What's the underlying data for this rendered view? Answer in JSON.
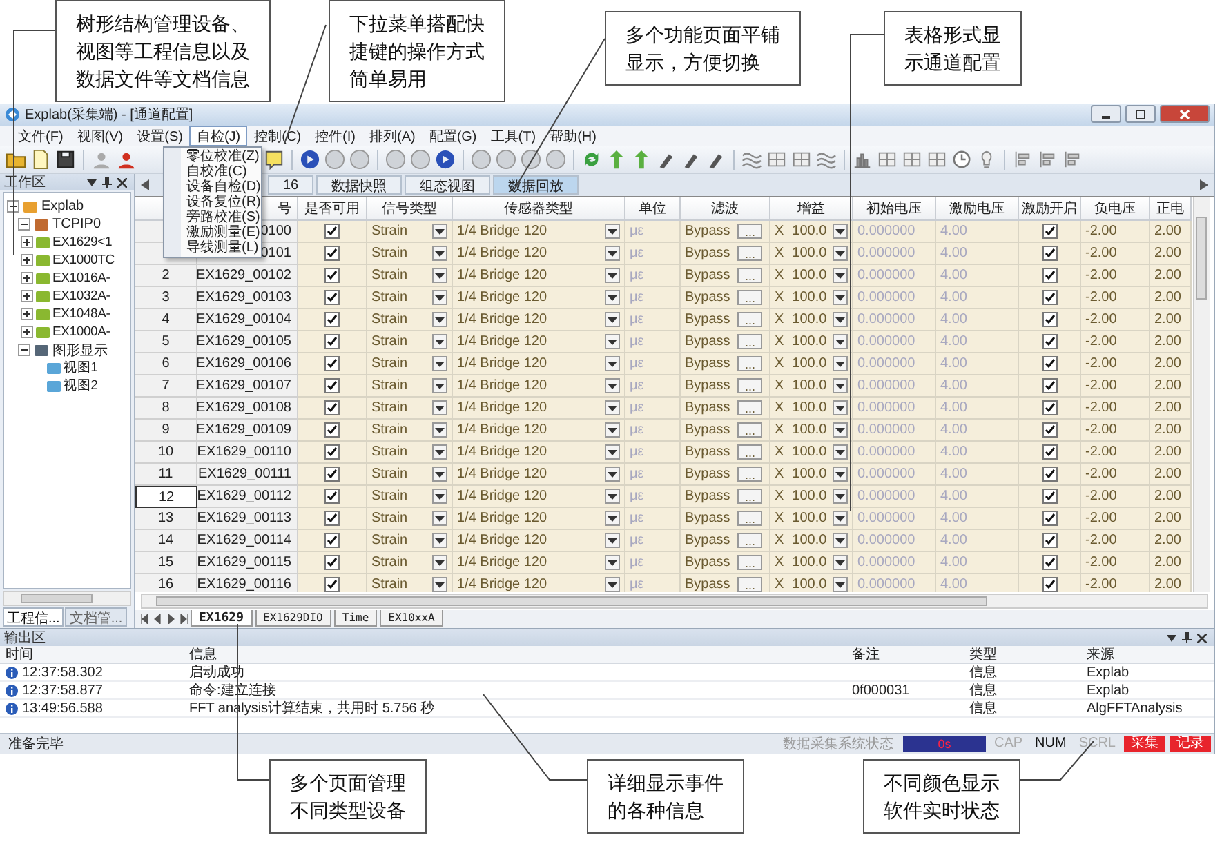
{
  "callouts_top": [
    {
      "text": "树形结构管理设备、视图等工程信息以及数据文件等文档信息"
    },
    {
      "text": "下拉菜单搭配快捷键的操作方式简单易用"
    },
    {
      "text": "多个功能页面平铺显示，方便切换"
    },
    {
      "text": "表格形式显示通道配置"
    }
  ],
  "window": {
    "title": "Explab(采集端) - [通道配置]"
  },
  "menu": [
    {
      "label": "文件(F)",
      "selected": false
    },
    {
      "label": "视图(V)",
      "selected": false
    },
    {
      "label": "设置(S)",
      "selected": false
    },
    {
      "label": "自检(J)",
      "selected": true
    },
    {
      "label": "控制(C)",
      "selected": false
    },
    {
      "label": "控件(I)",
      "selected": false
    },
    {
      "label": "排列(A)",
      "selected": false
    },
    {
      "label": "配置(G)",
      "selected": false
    },
    {
      "label": "工具(T)",
      "selected": false
    },
    {
      "label": "帮助(H)",
      "selected": false
    }
  ],
  "dropdown": [
    {
      "label": "零位校准(Z)"
    },
    {
      "label": "自校准(C)"
    },
    {
      "label": "设备自检(D)"
    },
    {
      "label": "设备复位(R)"
    },
    {
      "label": "旁路校准(S)"
    },
    {
      "label": "激励测量(E)"
    },
    {
      "label": "导线测量(L)"
    }
  ],
  "workspace": {
    "title": "工作区",
    "tree": [
      {
        "label": "Explab",
        "kind": "app",
        "expanded": true,
        "children": [
          {
            "label": "TCPIP0",
            "kind": "network",
            "expanded": true,
            "children": [
              {
                "label": "EX1629<1",
                "kind": "device",
                "expanded": false
              },
              {
                "label": "EX1000TC",
                "kind": "device",
                "expanded": false
              },
              {
                "label": "EX1016A-",
                "kind": "device",
                "expanded": false
              },
              {
                "label": "EX1032A-",
                "kind": "device",
                "expanded": false
              },
              {
                "label": "EX1048A-",
                "kind": "device",
                "expanded": false
              },
              {
                "label": "EX1000A-",
                "kind": "device",
                "expanded": false
              }
            ]
          },
          {
            "label": "图形显示",
            "kind": "monitor",
            "expanded": true,
            "children": [
              {
                "label": "视图1",
                "kind": "view"
              },
              {
                "label": "视图2",
                "kind": "view"
              }
            ]
          }
        ]
      }
    ],
    "tabs": [
      {
        "label": "工程信...",
        "selected": true
      },
      {
        "label": "文档管...",
        "selected": false
      }
    ]
  },
  "page_tabs": [
    {
      "label": "16",
      "selected": false
    },
    {
      "label": "数据快照",
      "selected": false
    },
    {
      "label": "组态视图",
      "selected": false
    },
    {
      "label": "数据回放",
      "selected": true
    }
  ],
  "table": {
    "columns": [
      "号",
      "是否可用",
      "信号类型",
      "传感器类型",
      "单位",
      "滤波",
      "增益",
      "初始电压",
      "激励电压",
      "激励开启",
      "负电压",
      "正电"
    ],
    "rows": [
      {
        "name": "0100",
        "selected": false,
        "enabled": true,
        "signal": "Strain",
        "sensor": "1/4 Bridge 120",
        "unit": "με",
        "filter": "Bypass",
        "filter_button": "...",
        "gain_prefix": "X",
        "gain": "100.0",
        "initial_voltage": "0.000000",
        "excitation_voltage": "4.00",
        "excitation_on": true,
        "negative_voltage": "-2.00",
        "positive_voltage": "2.00"
      },
      {
        "name": "0101",
        "selected": false,
        "enabled": true,
        "signal": "Strain",
        "sensor": "1/4 Bridge 120",
        "unit": "με",
        "filter": "Bypass",
        "filter_button": "...",
        "gain_prefix": "X",
        "gain": "100.0",
        "initial_voltage": "0.000000",
        "excitation_voltage": "4.00",
        "excitation_on": true,
        "negative_voltage": "-2.00",
        "positive_voltage": "2.00"
      },
      {
        "index": "2",
        "name": "EX1629_00102",
        "selected": false,
        "enabled": true,
        "signal": "Strain",
        "sensor": "1/4 Bridge 120",
        "unit": "με",
        "filter": "Bypass",
        "filter_button": "...",
        "gain_prefix": "X",
        "gain": "100.0",
        "initial_voltage": "0.000000",
        "excitation_voltage": "4.00",
        "excitation_on": true,
        "negative_voltage": "-2.00",
        "positive_voltage": "2.00"
      },
      {
        "index": "3",
        "name": "EX1629_00103",
        "selected": false,
        "enabled": true,
        "signal": "Strain",
        "sensor": "1/4 Bridge 120",
        "unit": "με",
        "filter": "Bypass",
        "filter_button": "...",
        "gain_prefix": "X",
        "gain": "100.0",
        "initial_voltage": "0.000000",
        "excitation_voltage": "4.00",
        "excitation_on": true,
        "negative_voltage": "-2.00",
        "positive_voltage": "2.00"
      },
      {
        "index": "4",
        "name": "EX1629_00104",
        "selected": false,
        "enabled": true,
        "signal": "Strain",
        "sensor": "1/4 Bridge 120",
        "unit": "με",
        "filter": "Bypass",
        "filter_button": "...",
        "gain_prefix": "X",
        "gain": "100.0",
        "initial_voltage": "0.000000",
        "excitation_voltage": "4.00",
        "excitation_on": true,
        "negative_voltage": "-2.00",
        "positive_voltage": "2.00"
      },
      {
        "index": "5",
        "name": "EX1629_00105",
        "selected": false,
        "enabled": true,
        "signal": "Strain",
        "sensor": "1/4 Bridge 120",
        "unit": "με",
        "filter": "Bypass",
        "filter_button": "...",
        "gain_prefix": "X",
        "gain": "100.0",
        "initial_voltage": "0.000000",
        "excitation_voltage": "4.00",
        "excitation_on": true,
        "negative_voltage": "-2.00",
        "positive_voltage": "2.00"
      },
      {
        "index": "6",
        "name": "EX1629_00106",
        "selected": false,
        "enabled": true,
        "signal": "Strain",
        "sensor": "1/4 Bridge 120",
        "unit": "με",
        "filter": "Bypass",
        "filter_button": "...",
        "gain_prefix": "X",
        "gain": "100.0",
        "initial_voltage": "0.000000",
        "excitation_voltage": "4.00",
        "excitation_on": true,
        "negative_voltage": "-2.00",
        "positive_voltage": "2.00"
      },
      {
        "index": "7",
        "name": "EX1629_00107",
        "selected": false,
        "enabled": true,
        "signal": "Strain",
        "sensor": "1/4 Bridge 120",
        "unit": "με",
        "filter": "Bypass",
        "filter_button": "...",
        "gain_prefix": "X",
        "gain": "100.0",
        "initial_voltage": "0.000000",
        "excitation_voltage": "4.00",
        "excitation_on": true,
        "negative_voltage": "-2.00",
        "positive_voltage": "2.00"
      },
      {
        "index": "8",
        "name": "EX1629_00108",
        "selected": false,
        "enabled": true,
        "signal": "Strain",
        "sensor": "1/4 Bridge 120",
        "unit": "με",
        "filter": "Bypass",
        "filter_button": "...",
        "gain_prefix": "X",
        "gain": "100.0",
        "initial_voltage": "0.000000",
        "excitation_voltage": "4.00",
        "excitation_on": true,
        "negative_voltage": "-2.00",
        "positive_voltage": "2.00"
      },
      {
        "index": "9",
        "name": "EX1629_00109",
        "selected": false,
        "enabled": true,
        "signal": "Strain",
        "sensor": "1/4 Bridge 120",
        "unit": "με",
        "filter": "Bypass",
        "filter_button": "...",
        "gain_prefix": "X",
        "gain": "100.0",
        "initial_voltage": "0.000000",
        "excitation_voltage": "4.00",
        "excitation_on": true,
        "negative_voltage": "-2.00",
        "positive_voltage": "2.00"
      },
      {
        "index": "10",
        "name": "EX1629_00110",
        "selected": false,
        "enabled": true,
        "signal": "Strain",
        "sensor": "1/4 Bridge 120",
        "unit": "με",
        "filter": "Bypass",
        "filter_button": "...",
        "gain_prefix": "X",
        "gain": "100.0",
        "initial_voltage": "0.000000",
        "excitation_voltage": "4.00",
        "excitation_on": true,
        "negative_voltage": "-2.00",
        "positive_voltage": "2.00"
      },
      {
        "index": "11",
        "name": "EX1629_00111",
        "selected": false,
        "enabled": true,
        "signal": "Strain",
        "sensor": "1/4 Bridge 120",
        "unit": "με",
        "filter": "Bypass",
        "filter_button": "...",
        "gain_prefix": "X",
        "gain": "100.0",
        "initial_voltage": "0.000000",
        "excitation_voltage": "4.00",
        "excitation_on": true,
        "negative_voltage": "-2.00",
        "positive_voltage": "2.00"
      },
      {
        "index": "12",
        "name": "EX1629_00112",
        "selected": true,
        "enabled": true,
        "signal": "Strain",
        "sensor": "1/4 Bridge 120",
        "unit": "με",
        "filter": "Bypass",
        "filter_button": "...",
        "gain_prefix": "X",
        "gain": "100.0",
        "initial_voltage": "0.000000",
        "excitation_voltage": "4.00",
        "excitation_on": true,
        "negative_voltage": "-2.00",
        "positive_voltage": "2.00"
      },
      {
        "index": "13",
        "name": "EX1629_00113",
        "selected": false,
        "enabled": true,
        "signal": "Strain",
        "sensor": "1/4 Bridge 120",
        "unit": "με",
        "filter": "Bypass",
        "filter_button": "...",
        "gain_prefix": "X",
        "gain": "100.0",
        "initial_voltage": "0.000000",
        "excitation_voltage": "4.00",
        "excitation_on": true,
        "negative_voltage": "-2.00",
        "positive_voltage": "2.00"
      },
      {
        "index": "14",
        "name": "EX1629_00114",
        "selected": false,
        "enabled": true,
        "signal": "Strain",
        "sensor": "1/4 Bridge 120",
        "unit": "με",
        "filter": "Bypass",
        "filter_button": "...",
        "gain_prefix": "X",
        "gain": "100.0",
        "initial_voltage": "0.000000",
        "excitation_voltage": "4.00",
        "excitation_on": true,
        "negative_voltage": "-2.00",
        "positive_voltage": "2.00"
      },
      {
        "index": "15",
        "name": "EX1629_00115",
        "selected": false,
        "enabled": true,
        "signal": "Strain",
        "sensor": "1/4 Bridge 120",
        "unit": "με",
        "filter": "Bypass",
        "filter_button": "...",
        "gain_prefix": "X",
        "gain": "100.0",
        "initial_voltage": "0.000000",
        "excitation_voltage": "4.00",
        "excitation_on": true,
        "negative_voltage": "-2.00",
        "positive_voltage": "2.00"
      },
      {
        "index": "16",
        "name": "EX1629_00116",
        "selected": false,
        "enabled": true,
        "signal": "Strain",
        "sensor": "1/4 Bridge 120",
        "unit": "με",
        "filter": "Bypass",
        "filter_button": "...",
        "gain_prefix": "X",
        "gain": "100.0",
        "initial_voltage": "0.000000",
        "excitation_voltage": "4.00",
        "excitation_on": true,
        "negative_voltage": "-2.00",
        "positive_voltage": "2.00"
      }
    ]
  },
  "sheet_tabs": [
    {
      "label": "EX1629",
      "selected": true
    },
    {
      "label": "EX1629DIO",
      "selected": false
    },
    {
      "label": "Time",
      "selected": false
    },
    {
      "label": "EX10xxA",
      "selected": false
    }
  ],
  "output": {
    "title": "输出区",
    "columns": [
      "时间",
      "信息",
      "备注",
      "类型",
      "来源"
    ],
    "rows": [
      {
        "time": "12:37:58.302",
        "message": "启动成功",
        "type": "信息",
        "source": "Explab"
      },
      {
        "time": "12:37:58.877",
        "message": "命令:建立连接",
        "note": "0f000031",
        "type": "信息",
        "source": "Explab"
      },
      {
        "time": "13:49:56.588",
        "message": "FFT analysis计算结束，共用时 5.756 秒",
        "type": "信息",
        "source": "AlgFFTAnalysis"
      }
    ]
  },
  "status_bar": {
    "message": "准备完毕",
    "system_label": "数据采集系统状态",
    "timer": "0s",
    "indicators": [
      {
        "label": "CAP",
        "on": false
      },
      {
        "label": "NUM",
        "on": true
      },
      {
        "label": "SCRL",
        "on": false
      }
    ],
    "states": [
      {
        "label": "采集",
        "color": "#e8242c"
      },
      {
        "label": "记录",
        "color": "#e8242c"
      }
    ]
  },
  "callouts_bottom": [
    {
      "text": "多个页面管理不同类型设备"
    },
    {
      "text": "详细显示事件的各种信息"
    },
    {
      "text": "不同颜色显示软件实时状态"
    }
  ]
}
